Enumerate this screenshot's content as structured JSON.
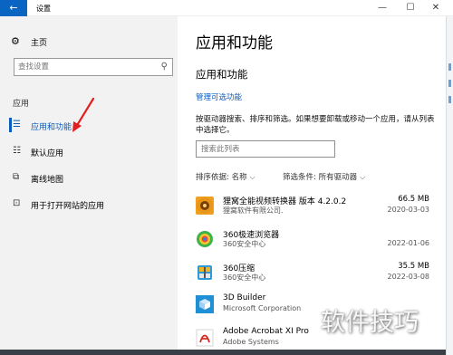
{
  "window": {
    "title": "设置",
    "back_glyph": "←",
    "minimize_glyph": "—",
    "maximize_glyph": "☐",
    "close_glyph": "✕"
  },
  "sidebar": {
    "home_label": "主页",
    "search_placeholder": "查找设置",
    "section_label": "应用",
    "items": [
      {
        "label": "应用和功能",
        "icon": "apps-list-icon",
        "active": true
      },
      {
        "label": "默认应用",
        "icon": "default-apps-icon",
        "active": false
      },
      {
        "label": "离线地图",
        "icon": "offline-map-icon",
        "active": false
      },
      {
        "label": "用于打开网站的应用",
        "icon": "web-apps-icon",
        "active": false
      }
    ]
  },
  "main": {
    "title": "应用和功能",
    "subtitle": "应用和功能",
    "optional_features_link": "管理可选功能",
    "description": "按驱动器搜索、排序和筛选。如果想要卸载或移动一个应用，请从列表中选择它。",
    "list_search_placeholder": "搜索此列表",
    "sort_label": "排序依据: 名称",
    "filter_label": "筛选条件: 所有驱动器",
    "apps": [
      {
        "name": "狸窝全能视频转换器 版本 4.2.0.2",
        "publisher": "狸窝软件有限公司.",
        "size": "66.5 MB",
        "date": "2020-03-03",
        "icon": "video-converter-icon",
        "color": "#c97a12"
      },
      {
        "name": "360极速浏览器",
        "publisher": "360安全中心",
        "size": "",
        "date": "2022-01-06",
        "icon": "360-browser-icon",
        "color": "#38b24a"
      },
      {
        "name": "360压缩",
        "publisher": "360安全中心",
        "size": "35.5 MB",
        "date": "2022-03-08",
        "icon": "360-zip-icon",
        "color": "#2f9ad8"
      },
      {
        "name": "3D Builder",
        "publisher": "Microsoft Corporation",
        "size": "",
        "date": "",
        "icon": "3d-builder-icon",
        "color": "#1f8fd6"
      },
      {
        "name": "Adobe Acrobat XI Pro",
        "publisher": "Adobe Systems",
        "size": "",
        "date": "",
        "icon": "adobe-acrobat-icon",
        "color": "#ffffff"
      }
    ]
  },
  "watermark": "软件技巧",
  "colors": {
    "accent": "#0a5cbf",
    "back_button": "#0a65c2",
    "sidebar_bg": "#f2f2f2"
  }
}
